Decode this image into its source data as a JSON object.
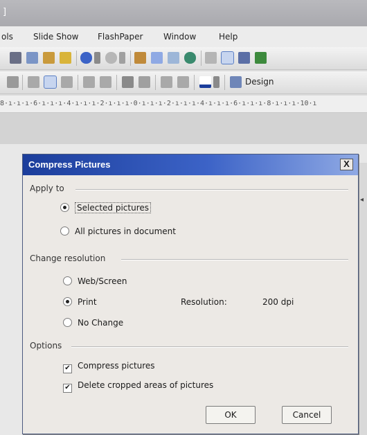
{
  "window": {
    "title_fragment": "]"
  },
  "menubar": {
    "items": [
      "ols",
      "Slide Show",
      "FlashPaper",
      "Window",
      "Help"
    ]
  },
  "toolbar2": {
    "design_label": "Design"
  },
  "ruler": {
    "text": "8·ı·ı·ı·6·ı·ı·ı·4·ı·ı·ı·2·ı·ı·ı·0·ı·ı·ı·2·ı·ı·ı·4·ı·ı·ı·6·ı·ı·ı·8·ı·ı·ı·10·ı"
  },
  "dialog": {
    "title": "Compress Pictures",
    "close_label": "X",
    "apply_to": {
      "label": "Apply to",
      "options": [
        "Selected pictures",
        "All pictures in document"
      ],
      "selected": "Selected pictures"
    },
    "change_resolution": {
      "label": "Change resolution",
      "options": [
        "Web/Screen",
        "Print",
        "No Change"
      ],
      "selected": "Print",
      "resolution_label": "Resolution:",
      "resolution_value": "200 dpi"
    },
    "options": {
      "label": "Options",
      "compress_pictures": "Compress pictures",
      "compress_checked": true,
      "delete_cropped": "Delete cropped areas of pictures",
      "delete_checked": true
    },
    "ok_label": "OK",
    "cancel_label": "Cancel"
  },
  "colors": {
    "titlebar_start": "#1b3d9b",
    "titlebar_end": "#8fa9e4",
    "dialog_bg": "#ece9e5"
  }
}
